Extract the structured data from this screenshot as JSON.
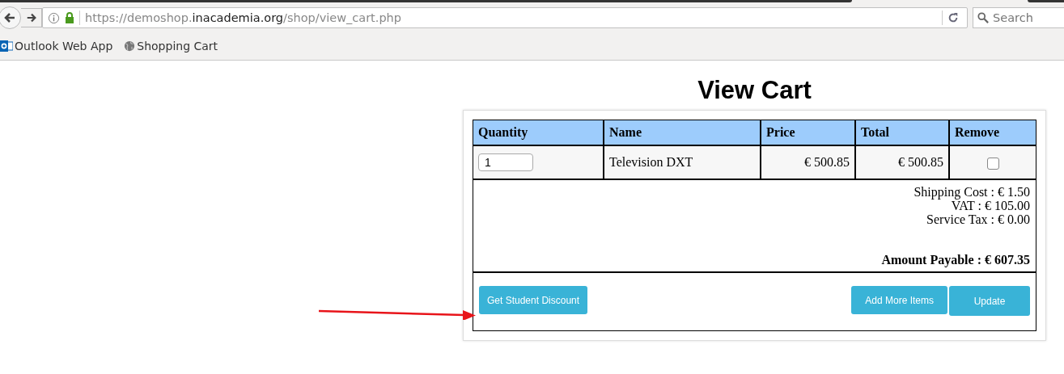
{
  "browser": {
    "url": {
      "scheme_host": "https://demoshop.",
      "domain": "inacademia.org",
      "path": "/shop/view_cart.php"
    },
    "search": {
      "placeholder": "Search"
    },
    "bookmarks": [
      {
        "label": "Outlook Web App",
        "kind": "outlook"
      },
      {
        "label": "Shopping Cart",
        "kind": "globe"
      }
    ]
  },
  "page": {
    "title": "View Cart",
    "table": {
      "columns": [
        "Quantity",
        "Name",
        "Price",
        "Total",
        "Remove"
      ],
      "rows": [
        {
          "quantity": "1",
          "name": "Television DXT",
          "price": "€ 500.85",
          "total": "€ 500.85",
          "remove_checked": false
        }
      ]
    },
    "summary": [
      "Shipping Cost : € 1.50",
      "VAT : € 105.00",
      "Service Tax : € 0.00"
    ],
    "amount_payable": "Amount Payable : € 607.35",
    "buttons": [
      {
        "label": "Get Student Discount",
        "kind": "discount"
      },
      {
        "label": "Add More Items",
        "kind": "action"
      },
      {
        "label": "Update",
        "kind": "action"
      }
    ]
  }
}
